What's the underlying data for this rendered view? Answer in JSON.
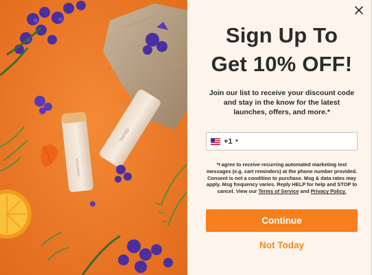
{
  "hero": {
    "product_labels": [
      "TINTED",
      "GARDENIA"
    ]
  },
  "close_label": "×",
  "title": {
    "line1": "Sign Up To",
    "line2": "Get 10% OFF!"
  },
  "subtitle": "Join our list to receive your discount code and stay in the know for the latest launches, offers, and more.*",
  "phone": {
    "country_flag": "us-flag-icon",
    "dial_code": "+1",
    "value": "",
    "placeholder": ""
  },
  "consent": {
    "text": "*I agree to receive recurring automated marketing text messages (e.g. cart reminders) at the phone number provided. Consent is not a condition to purchase. Msg & data rates may apply. Msg frequency varies. Reply HELP for help and STOP to cancel. View our",
    "terms_link": "Terms of Service",
    "conjunction": "and",
    "privacy_link": "Privacy Policy."
  },
  "buttons": {
    "continue": "Continue",
    "dismiss": "Not Today"
  },
  "colors": {
    "accent": "#f7801e",
    "panel_bg": "#fdf4ec",
    "hero_bg": "#ef7b2a",
    "text": "#2b2b2b"
  }
}
